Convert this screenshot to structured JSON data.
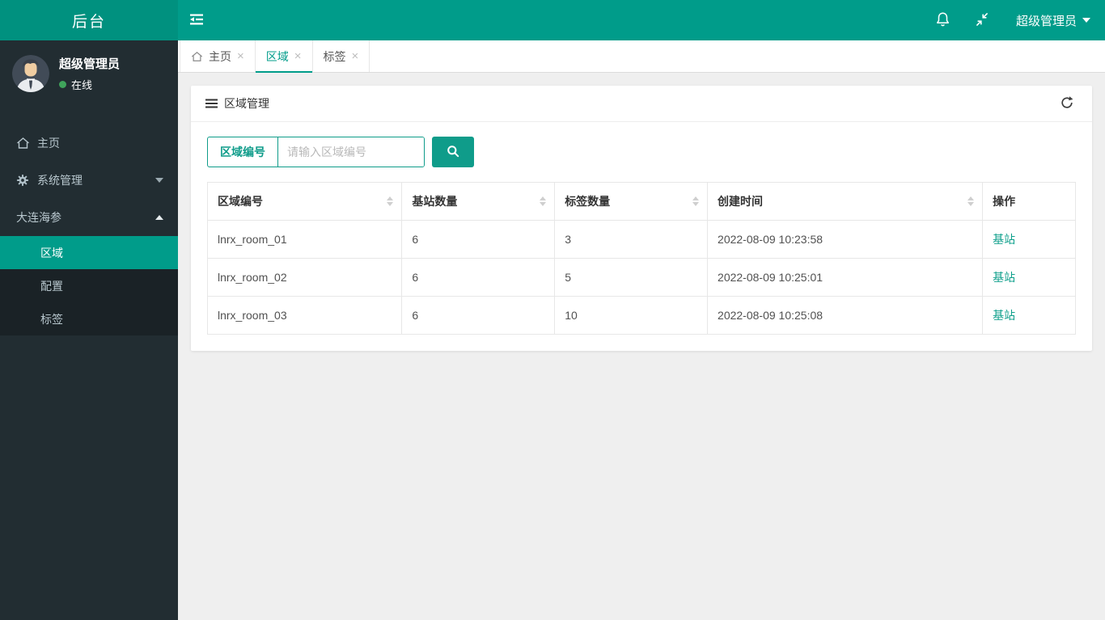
{
  "brand": {
    "title": "后台"
  },
  "header": {
    "user_label": "超级管理员",
    "icons": {
      "notifications": "bell-icon",
      "fullscreen": "compress-icon",
      "toggle": "outdent-icon"
    }
  },
  "sidebar": {
    "user": {
      "name": "超级管理员",
      "status": "在线"
    },
    "menu": [
      {
        "label": "主页",
        "icon": "home-icon"
      },
      {
        "label": "系统管理",
        "icon": "gear-icon",
        "caret": "down"
      },
      {
        "label": "大连海参",
        "caret": "up"
      }
    ],
    "submenu": [
      {
        "label": "区域",
        "active": true
      },
      {
        "label": "配置",
        "active": false
      },
      {
        "label": "标签",
        "active": false
      }
    ]
  },
  "tabs": [
    {
      "label": "主页",
      "icon": "home-icon",
      "active": false
    },
    {
      "label": "区域",
      "active": true
    },
    {
      "label": "标签",
      "active": false
    }
  ],
  "ui": {
    "close_glyph": "×"
  },
  "panel": {
    "title": "区域管理",
    "search": {
      "field_label": "区域编号",
      "placeholder": "请输入区域编号",
      "value": ""
    },
    "table": {
      "columns": [
        {
          "label": "区域编号",
          "sortable": true
        },
        {
          "label": "基站数量",
          "sortable": true
        },
        {
          "label": "标签数量",
          "sortable": true
        },
        {
          "label": "创建时间",
          "sortable": true
        },
        {
          "label": "操作",
          "sortable": false
        }
      ],
      "rows": [
        {
          "region": "lnrx_room_01",
          "stations": "6",
          "tags": "3",
          "created": "2022-08-09 10:23:58",
          "action": "基站"
        },
        {
          "region": "lnrx_room_02",
          "stations": "6",
          "tags": "5",
          "created": "2022-08-09 10:25:01",
          "action": "基站"
        },
        {
          "region": "lnrx_room_03",
          "stations": "6",
          "tags": "10",
          "created": "2022-08-09 10:25:08",
          "action": "基站"
        }
      ]
    }
  },
  "colors": {
    "accent_teal": "#009c8a",
    "logo_teal": "#00917f",
    "sidebar_bg": "#222d32",
    "submenu_bg": "#1a2226",
    "online_green": "#3fa45b",
    "content_bg": "#efefef",
    "table_border": "#e7e7e7"
  }
}
